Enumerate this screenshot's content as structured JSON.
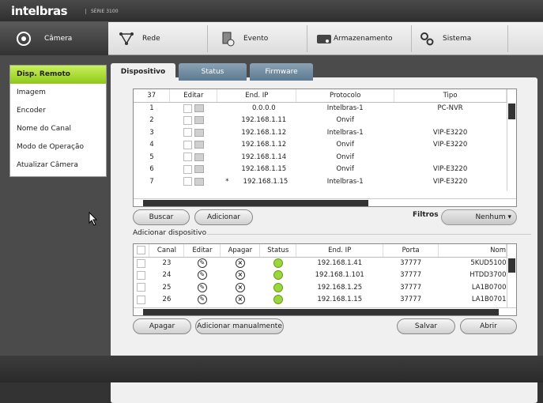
{
  "brand": {
    "name": "intelbras",
    "series": "SÉRIE 3100"
  },
  "nav": [
    {
      "label": "Câmera",
      "icon": "camera-icon",
      "active": true
    },
    {
      "label": "Rede",
      "icon": "network-icon"
    },
    {
      "label": "Evento",
      "icon": "event-icon"
    },
    {
      "label": "Armazenamento",
      "icon": "storage-icon"
    },
    {
      "label": "Sistema",
      "icon": "gears-icon"
    }
  ],
  "sidebar": [
    {
      "label": "Disp. Remoto",
      "active": true
    },
    {
      "label": "Imagem"
    },
    {
      "label": "Encoder"
    },
    {
      "label": "Nome do Canal"
    },
    {
      "label": "Modo de Operação"
    },
    {
      "label": "Atualizar Câmera"
    }
  ],
  "tabs": [
    {
      "label": "Dispositivo",
      "active": true
    },
    {
      "label": "Status"
    },
    {
      "label": "Firmware"
    }
  ],
  "search_table": {
    "headers": [
      "37",
      "Editar",
      "End. IP",
      "Protocolo",
      "Tipo"
    ],
    "rows": [
      {
        "n": "1",
        "ip": "0.0.0.0",
        "proto": "Intelbras-1",
        "type": "PC-NVR",
        "mark": ""
      },
      {
        "n": "2",
        "ip": "192.168.1.11",
        "proto": "Onvif",
        "type": "",
        "mark": ""
      },
      {
        "n": "3",
        "ip": "192.168.1.12",
        "proto": "Intelbras-1",
        "type": "VIP-E3220",
        "mark": ""
      },
      {
        "n": "4",
        "ip": "192.168.1.12",
        "proto": "Onvif",
        "type": "VIP-E3220",
        "mark": ""
      },
      {
        "n": "5",
        "ip": "192.168.1.14",
        "proto": "Onvif",
        "type": "",
        "mark": ""
      },
      {
        "n": "6",
        "ip": "192.168.1.15",
        "proto": "Onvif",
        "type": "VIP-E3220",
        "mark": ""
      },
      {
        "n": "7",
        "ip": "192.168.1.15",
        "proto": "Intelbras-1",
        "type": "VIP-E3220",
        "mark": "*"
      }
    ]
  },
  "buttons": {
    "buscar": "Buscar",
    "adicionar": "Adicionar",
    "apagar": "Apagar",
    "adicionar_manual": "Adicionar manualmente",
    "salvar": "Salvar",
    "abrir": "Abrir"
  },
  "filter": {
    "label": "Filtros",
    "value": "Nenhum"
  },
  "added_section": "Adicionar dispositivo",
  "added_table": {
    "headers": [
      "Canal",
      "Editar",
      "Apagar",
      "Status",
      "End. IP",
      "Porta",
      "Nom"
    ],
    "rows": [
      {
        "canal": "23",
        "ip": "192.168.1.41",
        "porta": "37777",
        "nome": "5KUD5100"
      },
      {
        "canal": "24",
        "ip": "192.168.1.101",
        "porta": "37777",
        "nome": "HTDD3700"
      },
      {
        "canal": "25",
        "ip": "192.168.1.25",
        "porta": "37777",
        "nome": "LA1B0700"
      },
      {
        "canal": "26",
        "ip": "192.168.1.15",
        "porta": "37777",
        "nome": "LA1B0701"
      }
    ]
  }
}
